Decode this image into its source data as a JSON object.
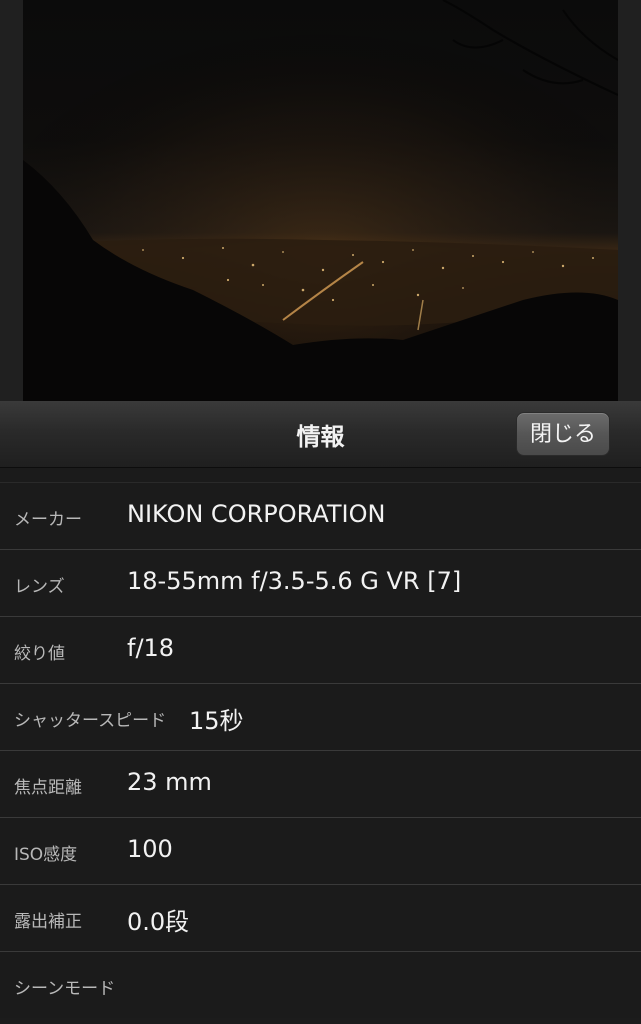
{
  "header": {
    "title": "情報",
    "close_label": "閉じる"
  },
  "info_rows": [
    {
      "label": "メーカー",
      "value": "NIKON CORPORATION"
    },
    {
      "label": "レンズ",
      "value": "18-55mm f/3.5-5.6 G VR [7]"
    },
    {
      "label": "絞り値",
      "value": "f/18"
    },
    {
      "label": "シャッタースピード",
      "value": "15秒"
    },
    {
      "label": "焦点距離",
      "value": "23 mm"
    },
    {
      "label": "ISO感度",
      "value": "100"
    },
    {
      "label": "露出補正",
      "value": "0.0段"
    },
    {
      "label": "シーンモード",
      "value": ""
    }
  ],
  "colors": {
    "background": "#1b1b1b",
    "separator": "#3a3a3a",
    "label_text": "#b8b8b8",
    "value_text": "#f2f2f2"
  }
}
